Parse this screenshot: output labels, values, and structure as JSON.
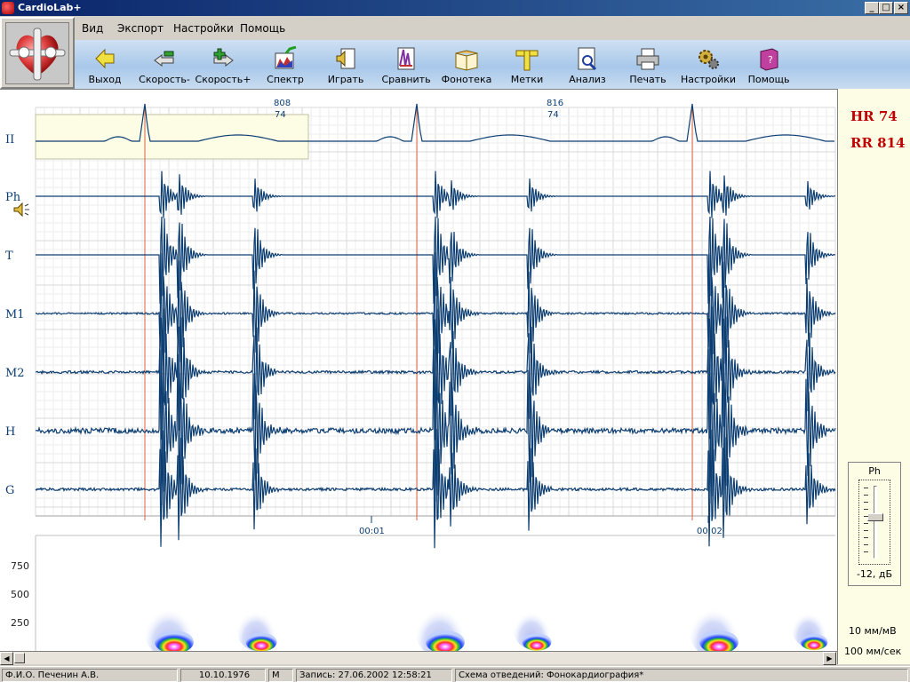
{
  "window": {
    "title": "CardioLab+",
    "min": "_",
    "max": "□",
    "close": "×"
  },
  "menu": [
    {
      "label": "Вид"
    },
    {
      "label": "Экспорт"
    },
    {
      "label": "Настройки"
    },
    {
      "label": "Помощь"
    }
  ],
  "toolbar": [
    {
      "label": "Выход",
      "icon": "exit-arrow-icon"
    },
    {
      "label": "Скорость-",
      "icon": "speed-down-icon"
    },
    {
      "label": "Скорость+",
      "icon": "speed-up-icon"
    },
    {
      "label": "Спектр",
      "icon": "spectrum-icon"
    },
    {
      "label": "Играть",
      "icon": "play-sound-icon"
    },
    {
      "label": "Сравнить",
      "icon": "compare-icon"
    },
    {
      "label": "Фонотека",
      "icon": "library-book-icon"
    },
    {
      "label": "Метки",
      "icon": "marks-ruler-icon"
    },
    {
      "label": "Анализ",
      "icon": "analysis-magnifier-icon"
    },
    {
      "label": "Печать",
      "icon": "printer-icon"
    },
    {
      "label": "Настройки",
      "icon": "settings-gears-icon"
    },
    {
      "label": "Помощь",
      "icon": "help-book-icon"
    }
  ],
  "leads": [
    {
      "name": "II"
    },
    {
      "name": "Ph"
    },
    {
      "name": "T"
    },
    {
      "name": "M1"
    },
    {
      "name": "M2"
    },
    {
      "name": "H"
    },
    {
      "name": "G"
    }
  ],
  "rr_labels": [
    {
      "rr": "808",
      "hr": "74"
    },
    {
      "rr": "816",
      "hr": "74"
    }
  ],
  "time_labels": [
    "00:01",
    "00:02"
  ],
  "spectrum_ticks": [
    "750",
    "500",
    "250"
  ],
  "vitals": {
    "hr": "HR 74",
    "rr": "RR 814"
  },
  "volume": {
    "channel": "Ph",
    "value": "-12, дБ",
    "level": 0.6
  },
  "scale": {
    "amplitude": "10 мм/мВ",
    "speed": "100 мм/сек"
  },
  "status": {
    "name": "Ф.И.О. Печенин А.В.",
    "dob": "10.10.1976",
    "sex": "М",
    "record": "Запись: 27.06.2002 12:58:21",
    "scheme": "Схема отведений: Фонокардиография*"
  },
  "colors": {
    "trace": "#0d3e72",
    "marker": "#e06040",
    "accent": "#c00000"
  }
}
